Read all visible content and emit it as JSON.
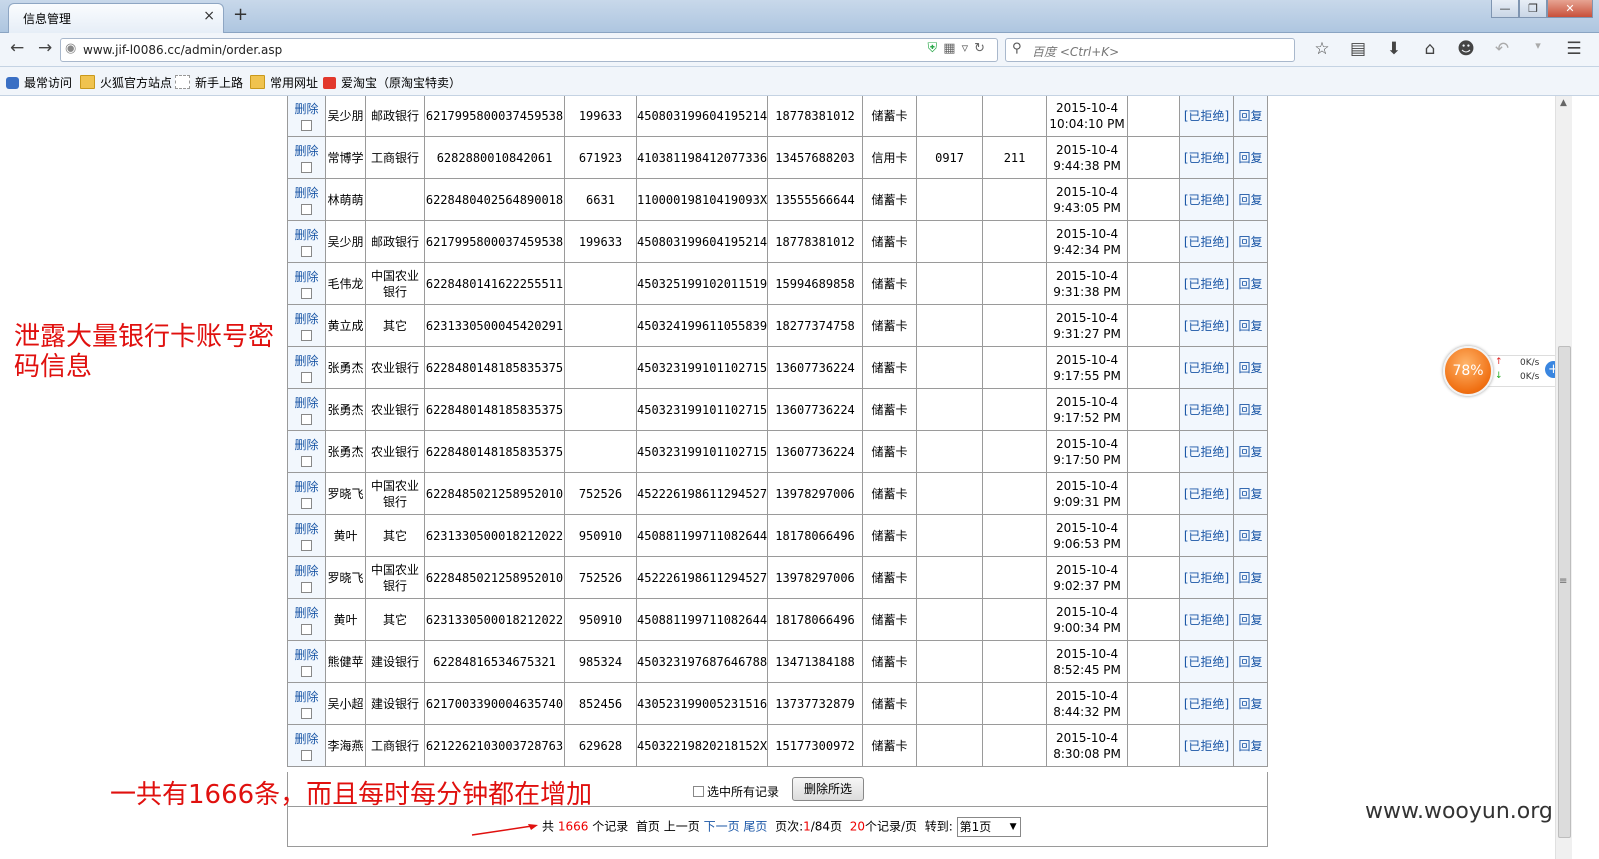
{
  "browser": {
    "tab_title": "信息管理",
    "tab_close": "×",
    "new_tab": "+",
    "url": "www.jif-l0086.cc/admin/order.asp",
    "search_placeholder": "百度 <Ctrl+K>",
    "window_controls": [
      "—",
      "❐",
      "✕"
    ],
    "bookmarks": [
      "最常访问",
      "火狐官方站点",
      "新手上路",
      "常用网址",
      "爱淘宝（原淘宝特卖）"
    ]
  },
  "annotations": {
    "left_note": "泄露大量银行卡账号密码信息",
    "bottom_note": "一共有1666条，而且每时每分钟都在增加",
    "watermark": "www.wooyun.org",
    "annotation_color": "#e0100e"
  },
  "net_widget": {
    "percent": "78%",
    "up_speed": "0K/s",
    "down_speed": "0K/s",
    "up_icon": "↑",
    "down_icon": "↓",
    "plus": "+"
  },
  "table": {
    "delete_label": "删除",
    "refused_label": "[已拒绝]",
    "reply_label": "回复",
    "rows": [
      {
        "name": "吴少朋",
        "bank": "邮政银行",
        "card": "6217995800037459538",
        "pin": "199633",
        "id_no": "450803199604195214",
        "phone": "18778381012",
        "card_type": "储蓄卡",
        "expiry": "",
        "cvv": "",
        "date": "2015-10-4",
        "time": "10:04:10 PM"
      },
      {
        "name": "常博学",
        "bank": "工商银行",
        "card": "6282880010842061",
        "pin": "671923",
        "id_no": "410381198412077336",
        "phone": "13457688203",
        "card_type": "信用卡",
        "expiry": "0917",
        "cvv": "211",
        "date": "2015-10-4",
        "time": "9:44:38 PM"
      },
      {
        "name": "林萌萌",
        "bank": "",
        "card": "6228480402564890018",
        "pin": "6631",
        "id_no": "11000019810419093X",
        "phone": "13555566644",
        "card_type": "储蓄卡",
        "expiry": "",
        "cvv": "",
        "date": "2015-10-4",
        "time": "9:43:05 PM"
      },
      {
        "name": "吴少朋",
        "bank": "邮政银行",
        "card": "6217995800037459538",
        "pin": "199633",
        "id_no": "450803199604195214",
        "phone": "18778381012",
        "card_type": "储蓄卡",
        "expiry": "",
        "cvv": "",
        "date": "2015-10-4",
        "time": "9:42:34 PM"
      },
      {
        "name": "毛伟龙",
        "bank": "中国农业银行",
        "card": "6228480141622255511",
        "pin": "",
        "id_no": "450325199102011519",
        "phone": "15994689858",
        "card_type": "储蓄卡",
        "expiry": "",
        "cvv": "",
        "date": "2015-10-4",
        "time": "9:31:38 PM"
      },
      {
        "name": "黄立成",
        "bank": "其它",
        "card": "6231330500045420291",
        "pin": "",
        "id_no": "450324199611055839",
        "phone": "18277374758",
        "card_type": "储蓄卡",
        "expiry": "",
        "cvv": "",
        "date": "2015-10-4",
        "time": "9:31:27 PM"
      },
      {
        "name": "张勇杰",
        "bank": "农业银行",
        "card": "6228480148185835375",
        "pin": "",
        "id_no": "450323199101102715",
        "phone": "13607736224",
        "card_type": "储蓄卡",
        "expiry": "",
        "cvv": "",
        "date": "2015-10-4",
        "time": "9:17:55 PM"
      },
      {
        "name": "张勇杰",
        "bank": "农业银行",
        "card": "6228480148185835375",
        "pin": "",
        "id_no": "450323199101102715",
        "phone": "13607736224",
        "card_type": "储蓄卡",
        "expiry": "",
        "cvv": "",
        "date": "2015-10-4",
        "time": "9:17:52 PM"
      },
      {
        "name": "张勇杰",
        "bank": "农业银行",
        "card": "6228480148185835375",
        "pin": "",
        "id_no": "450323199101102715",
        "phone": "13607736224",
        "card_type": "储蓄卡",
        "expiry": "",
        "cvv": "",
        "date": "2015-10-4",
        "time": "9:17:50 PM"
      },
      {
        "name": "罗晓飞",
        "bank": "中国农业银行",
        "card": "6228485021258952010",
        "pin": "752526",
        "id_no": "452226198611294527",
        "phone": "13978297006",
        "card_type": "储蓄卡",
        "expiry": "",
        "cvv": "",
        "date": "2015-10-4",
        "time": "9:09:31 PM"
      },
      {
        "name": "黄叶",
        "bank": "其它",
        "card": "6231330500018212022",
        "pin": "950910",
        "id_no": "450881199711082644",
        "phone": "18178066496",
        "card_type": "储蓄卡",
        "expiry": "",
        "cvv": "",
        "date": "2015-10-4",
        "time": "9:06:53 PM"
      },
      {
        "name": "罗晓飞",
        "bank": "中国农业银行",
        "card": "6228485021258952010",
        "pin": "752526",
        "id_no": "452226198611294527",
        "phone": "13978297006",
        "card_type": "储蓄卡",
        "expiry": "",
        "cvv": "",
        "date": "2015-10-4",
        "time": "9:02:37 PM"
      },
      {
        "name": "黄叶",
        "bank": "其它",
        "card": "6231330500018212022",
        "pin": "950910",
        "id_no": "450881199711082644",
        "phone": "18178066496",
        "card_type": "储蓄卡",
        "expiry": "",
        "cvv": "",
        "date": "2015-10-4",
        "time": "9:00:34 PM"
      },
      {
        "name": "熊健苹",
        "bank": "建设银行",
        "card": "62284816534675321",
        "pin": "985324",
        "id_no": "450323197687646788",
        "phone": "13471384188",
        "card_type": "储蓄卡",
        "expiry": "",
        "cvv": "",
        "date": "2015-10-4",
        "time": "8:52:45 PM"
      },
      {
        "name": "吴小超",
        "bank": "建设银行",
        "card": "6217003390004635740",
        "pin": "852456",
        "id_no": "430523199005231516",
        "phone": "13737732879",
        "card_type": "储蓄卡",
        "expiry": "",
        "cvv": "",
        "date": "2015-10-4",
        "time": "8:44:32 PM"
      },
      {
        "name": "李海燕",
        "bank": "工商银行",
        "card": "6212262103003728763",
        "pin": "629628",
        "id_no": "45032219820218152X",
        "phone": "15177300972",
        "card_type": "储蓄卡",
        "expiry": "",
        "cvv": "",
        "date": "2015-10-4",
        "time": "8:30:08 PM"
      }
    ]
  },
  "footer": {
    "select_all_label": "选中所有记录",
    "delete_selected_label": "删除所选",
    "pager": {
      "total_prefix": "共",
      "total": "1666",
      "total_suffix": "个记录",
      "first": "首页",
      "prev": "上一页",
      "next": "下一页",
      "last": "尾页",
      "page_prefix": "页次:",
      "current_page": "1",
      "page_total": "/84页",
      "per_page": "20",
      "per_page_suffix": "个记录/页",
      "goto_label": "转到:",
      "goto_value": "第1页"
    }
  }
}
